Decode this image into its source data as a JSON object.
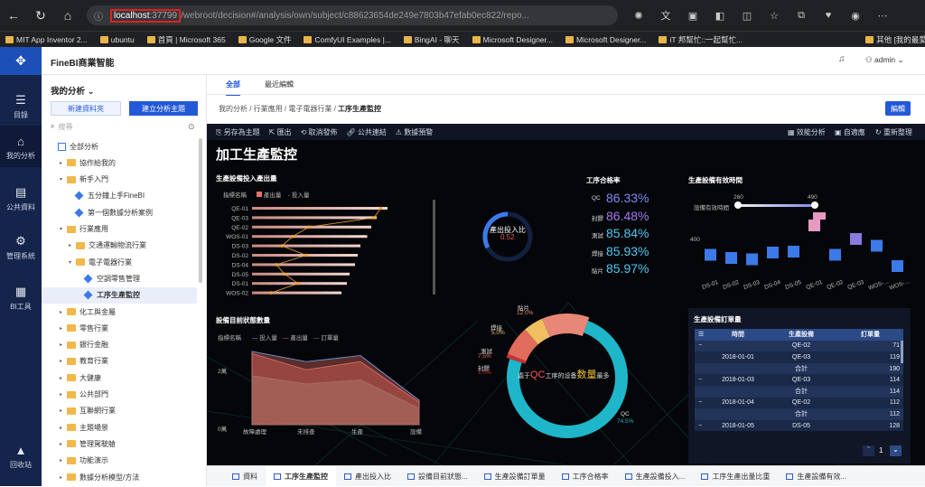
{
  "browser": {
    "url_host": "localhost",
    "url_port": ":37799",
    "url_path": "/webroot/decision#/analysis/own/subject/c88623654de249e7803b47efab0ec822/repo...",
    "bookmarks": [
      "MIT App Inventor 2...",
      "ubuntu",
      "首頁 | Microsoft 365",
      "Google 文件",
      "ComfyUI Examples |...",
      "BingAI - 聊天",
      "Microsoft Designer...",
      "Microsoft Designer...",
      "iT 邦幫忙::一起幫忙...",
      "其他 [我的最愛]"
    ]
  },
  "app": {
    "title": "FineBI商業智能",
    "user": "admin"
  },
  "rail": [
    "目錄",
    "我的分析",
    "公共資料",
    "管理系統",
    "BI工具",
    "回收站"
  ],
  "tree": {
    "title": "我的分析",
    "new_folder": "新建資料夾",
    "new_subject": "建立分析主題",
    "search_placeholder": "搜尋",
    "nodes": [
      "全部分析",
      "協作給我的",
      "新手入門",
      "五分鐘上手FineBI",
      "第一個數據分析案例",
      "行業應用",
      "交通運輸物流行業",
      "電子電器行業",
      "空調零售管理",
      "工序生產監控",
      "化工與金屬",
      "零售行業",
      "銀行金融",
      "教育行業",
      "大健康",
      "公共部門",
      "互聯網行業",
      "主題場景",
      "管理駕駛艙",
      "功能演示",
      "數據分析模型/方法"
    ]
  },
  "main": {
    "tabs": [
      "全部",
      "最近編輯"
    ],
    "breadcrumb": [
      "我的分析",
      "行業應用",
      "電子電器行業",
      "工序生產監控"
    ],
    "edit": "編輯",
    "toolbar_left": [
      "另存為主題",
      "匯出",
      "取消發佈",
      "公共連結",
      "數據預警"
    ],
    "toolbar_right": [
      "效能分析",
      "自適應",
      "重新整理"
    ]
  },
  "dashboard": {
    "title": "加工生產監控",
    "w1": {
      "title": "生產設備投入產出量",
      "legend_title": "指標名稱",
      "legend": [
        "產出量",
        "投入量"
      ]
    },
    "gauge": {
      "label": "產出投入比",
      "value": "0.52"
    },
    "rates": {
      "title": "工序合格率"
    },
    "util": {
      "title": "生產設備有效時間",
      "legend": "設備有效時間",
      "low": "260",
      "high": "490",
      "yval": "400"
    },
    "w3": {
      "title": "設備目前狀態數量",
      "legend_title": "指標名稱",
      "legend": [
        "投入量",
        "產出量",
        "訂單量"
      ],
      "ytick": "2萬",
      "ytick2": "0萬",
      "x": [
        "故障處理",
        "未排查",
        "生產",
        "設備"
      ]
    },
    "donut": {
      "center_pre": "處于",
      "center_big": "QC",
      "center_mid": "工序的设备",
      "center_big2": "数量",
      "center_post": "最多",
      "labels": [
        "貼片",
        "12.0%",
        "焊接",
        "5.0%",
        "測試",
        "7.5%",
        "封膠",
        "1.0%",
        "QC",
        "74.5%"
      ]
    },
    "orders": {
      "title": "生產設備訂單量",
      "headers": [
        "時間",
        "生產設備",
        "訂單量"
      ],
      "total": "合計",
      "page": "1"
    }
  },
  "chart_data": [
    {
      "type": "bar",
      "title": "生產設備投入產出量",
      "categories": [
        "QE-01",
        "QE-03",
        "QE-02",
        "WOS-01",
        "DS-03",
        "DS-02",
        "DS-04",
        "DS-05",
        "DS-01",
        "WOS-02"
      ],
      "series": [
        {
          "name": "產出量",
          "values": [
            100,
            92,
            88,
            85,
            80,
            78,
            76,
            72,
            70,
            66
          ]
        },
        {
          "name": "投入量",
          "values": [
            95,
            90,
            42,
            30,
            22,
            40,
            18,
            24,
            34,
            14
          ]
        }
      ]
    },
    {
      "type": "table",
      "title": "工序合格率",
      "rows": [
        [
          "QC",
          "86.33%"
        ],
        [
          "封膠",
          "86.48%"
        ],
        [
          "測試",
          "85.84%"
        ],
        [
          "焊接",
          "85.93%"
        ],
        [
          "貼片",
          "85.97%"
        ]
      ]
    },
    {
      "type": "scatter",
      "title": "生產設備有效時間",
      "categories": [
        "DS-01",
        "DS-02",
        "DS-03",
        "DS-04",
        "DS-05",
        "QE-01",
        "QE-02",
        "QE-03",
        "WOS-...",
        "WOS-..."
      ],
      "values": [
        405,
        398,
        395,
        410,
        412,
        470,
        405,
        440,
        425,
        380
      ]
    },
    {
      "type": "area",
      "title": "設備目前狀態數量",
      "categories": [
        "故障處理",
        "未排查",
        "生產",
        "設備"
      ],
      "series": [
        {
          "name": "投入量",
          "values": [
            18000,
            15500,
            17000,
            6000
          ]
        },
        {
          "name": "產出量",
          "values": [
            17500,
            13500,
            15500,
            5500
          ]
        },
        {
          "name": "訂單量",
          "values": [
            12000,
            10000,
            11000,
            4000
          ]
        }
      ]
    },
    {
      "type": "pie",
      "title": "工序",
      "slices": [
        {
          "label": "QC",
          "value": 74.5
        },
        {
          "label": "貼片",
          "value": 12.0
        },
        {
          "label": "測試",
          "value": 7.5
        },
        {
          "label": "焊接",
          "value": 5.0
        },
        {
          "label": "封膠",
          "value": 1.0
        }
      ]
    },
    {
      "type": "table",
      "title": "生產設備訂單量",
      "columns": [
        "時間",
        "生產設備",
        "訂單量"
      ],
      "rows": [
        [
          "2018-01-01",
          "QE-02",
          "71"
        ],
        [
          "2018-01-01",
          "QE-03",
          "119"
        ],
        [
          "2018-01-01",
          "合計",
          "190"
        ],
        [
          "2018-01-03",
          "QE-03",
          "114"
        ],
        [
          "2018-01-03",
          "合計",
          "114"
        ],
        [
          "2018-01-04",
          "QE-02",
          "112"
        ],
        [
          "2018-01-04",
          "合計",
          "112"
        ],
        [
          "2018-01-05",
          "DS-05",
          "128"
        ]
      ]
    }
  ],
  "bottom_tabs": [
    "資料",
    "工序生產監控",
    "產出投入比",
    "設備目前狀態...",
    "生產設備訂單量",
    "工序合格率",
    "生產設備投入...",
    "工序生產出量比重",
    "生產設備有效..."
  ]
}
